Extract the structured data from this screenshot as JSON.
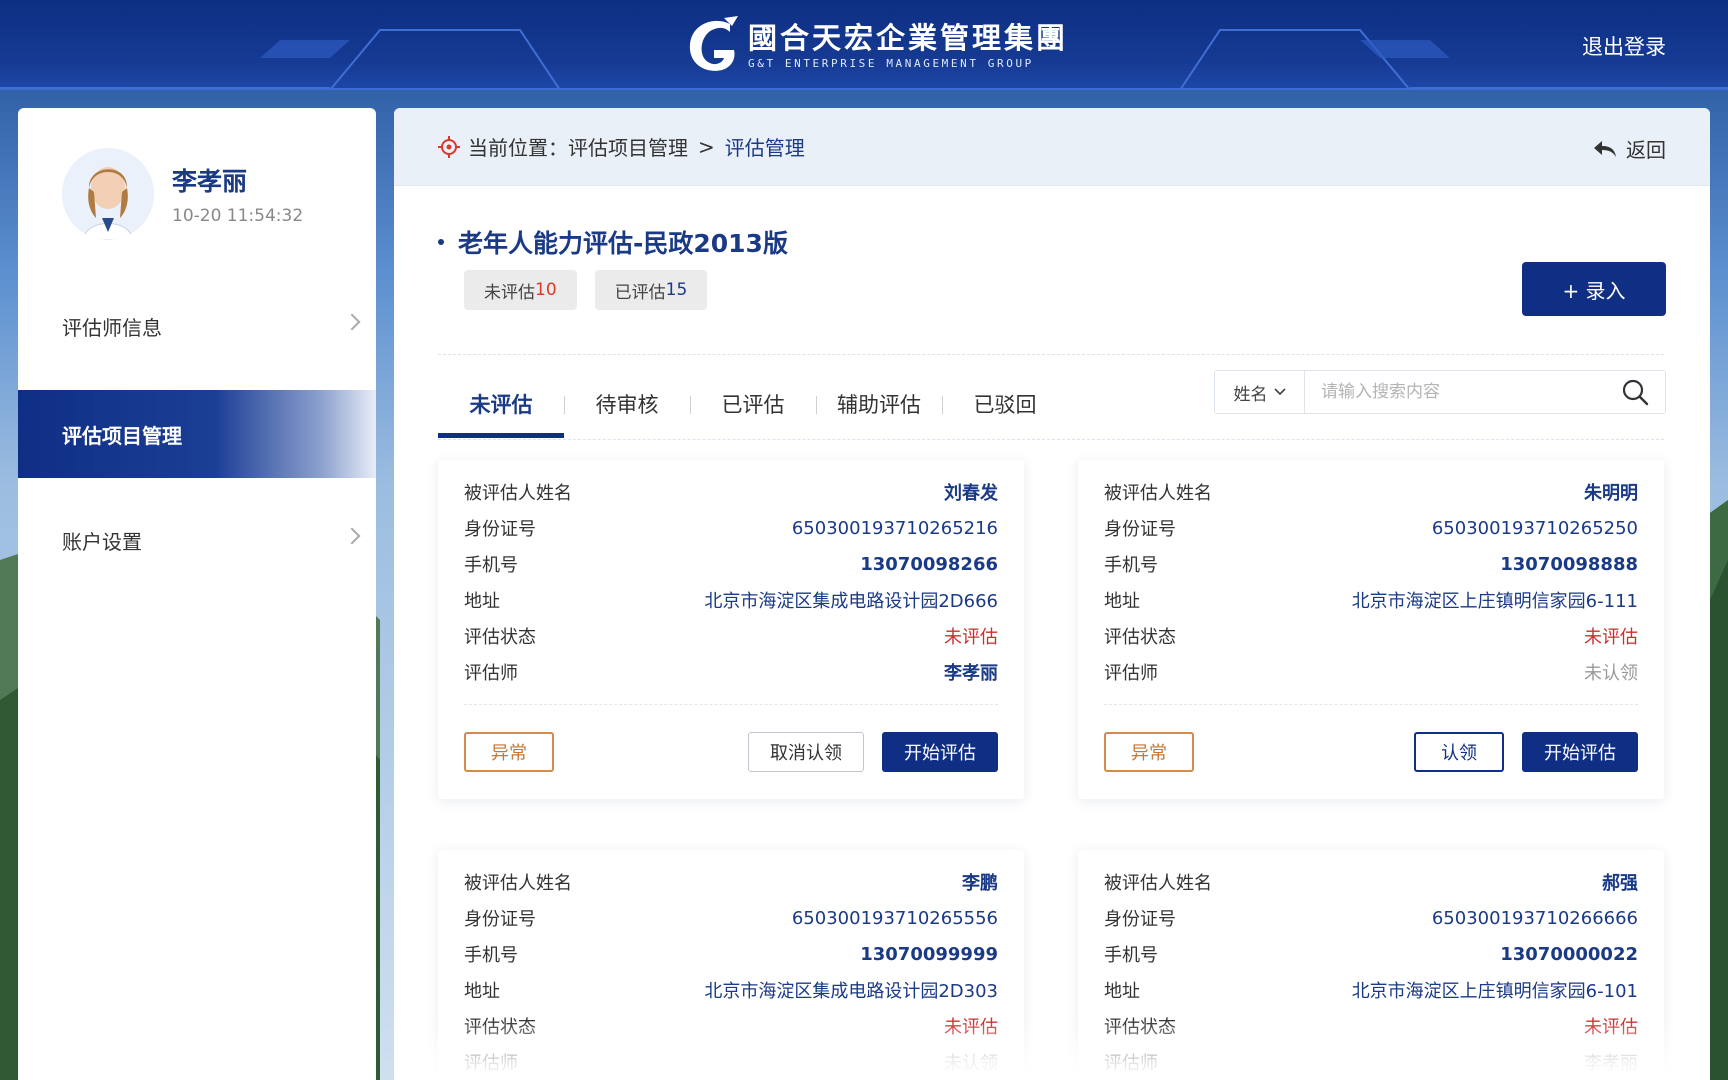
{
  "header": {
    "logo_cn": "國合天宏企業管理集團",
    "logo_en": "G&T  ENTERPRISE  MANAGEMENT  GROUP",
    "logout_label": "退出登录"
  },
  "profile": {
    "name": "李孝丽",
    "time": "10-20  11:54:32"
  },
  "sidebar": {
    "items": [
      {
        "label": "评估师信息"
      },
      {
        "label": "评估项目管理"
      },
      {
        "label": "账户设置"
      }
    ]
  },
  "breadcrumb": {
    "prefix": "当前位置：",
    "parent": "评估项目管理",
    "separator": ">",
    "current": "评估管理",
    "back_label": "返回"
  },
  "project": {
    "title": "老年人能力评估-民政2013版",
    "pending_label": "未评估",
    "pending_count": "10",
    "done_label": "已评估",
    "done_count": "15",
    "add_label": "+ 录入"
  },
  "tabs": [
    {
      "label": "未评估"
    },
    {
      "label": "待审核"
    },
    {
      "label": "已评估"
    },
    {
      "label": "辅助评估"
    },
    {
      "label": "已驳回"
    }
  ],
  "search": {
    "field": "姓名",
    "placeholder": "请输入搜索内容",
    "value": ""
  },
  "card_labels": {
    "name": "被评估人姓名",
    "id": "身份证号",
    "phone": "手机号",
    "address": "地址",
    "status": "评估状态",
    "assessor": "评估师"
  },
  "actions": {
    "abnormal": "异常",
    "unclaim": "取消认领",
    "claim": "认领",
    "start": "开始评估"
  },
  "cards": [
    {
      "name": "刘春发",
      "id": "650300193710265216",
      "phone": "13070098266",
      "address": "北京市海淀区集成电路设计园2D666",
      "status": "未评估",
      "assessor": "李孝丽"
    },
    {
      "name": "朱明明",
      "id": "650300193710265250",
      "phone": "13070098888",
      "address": "北京市海淀区上庄镇明信家园6-111",
      "status": "未评估",
      "assessor": "未认领"
    },
    {
      "name": "李鹏",
      "id": "650300193710265556",
      "phone": "13070099999",
      "address": "北京市海淀区集成电路设计园2D303",
      "status": "未评估",
      "assessor": "未认领"
    },
    {
      "name": "郝强",
      "id": "650300193710266666",
      "phone": "13070000022",
      "address": "北京市海淀区上庄镇明信家园6-101",
      "status": "未评估",
      "assessor": "李孝丽"
    }
  ],
  "colors": {
    "primary": "#0f2f85",
    "accent_red": "#c8302a",
    "abnormal_orange": "#c8762e"
  }
}
